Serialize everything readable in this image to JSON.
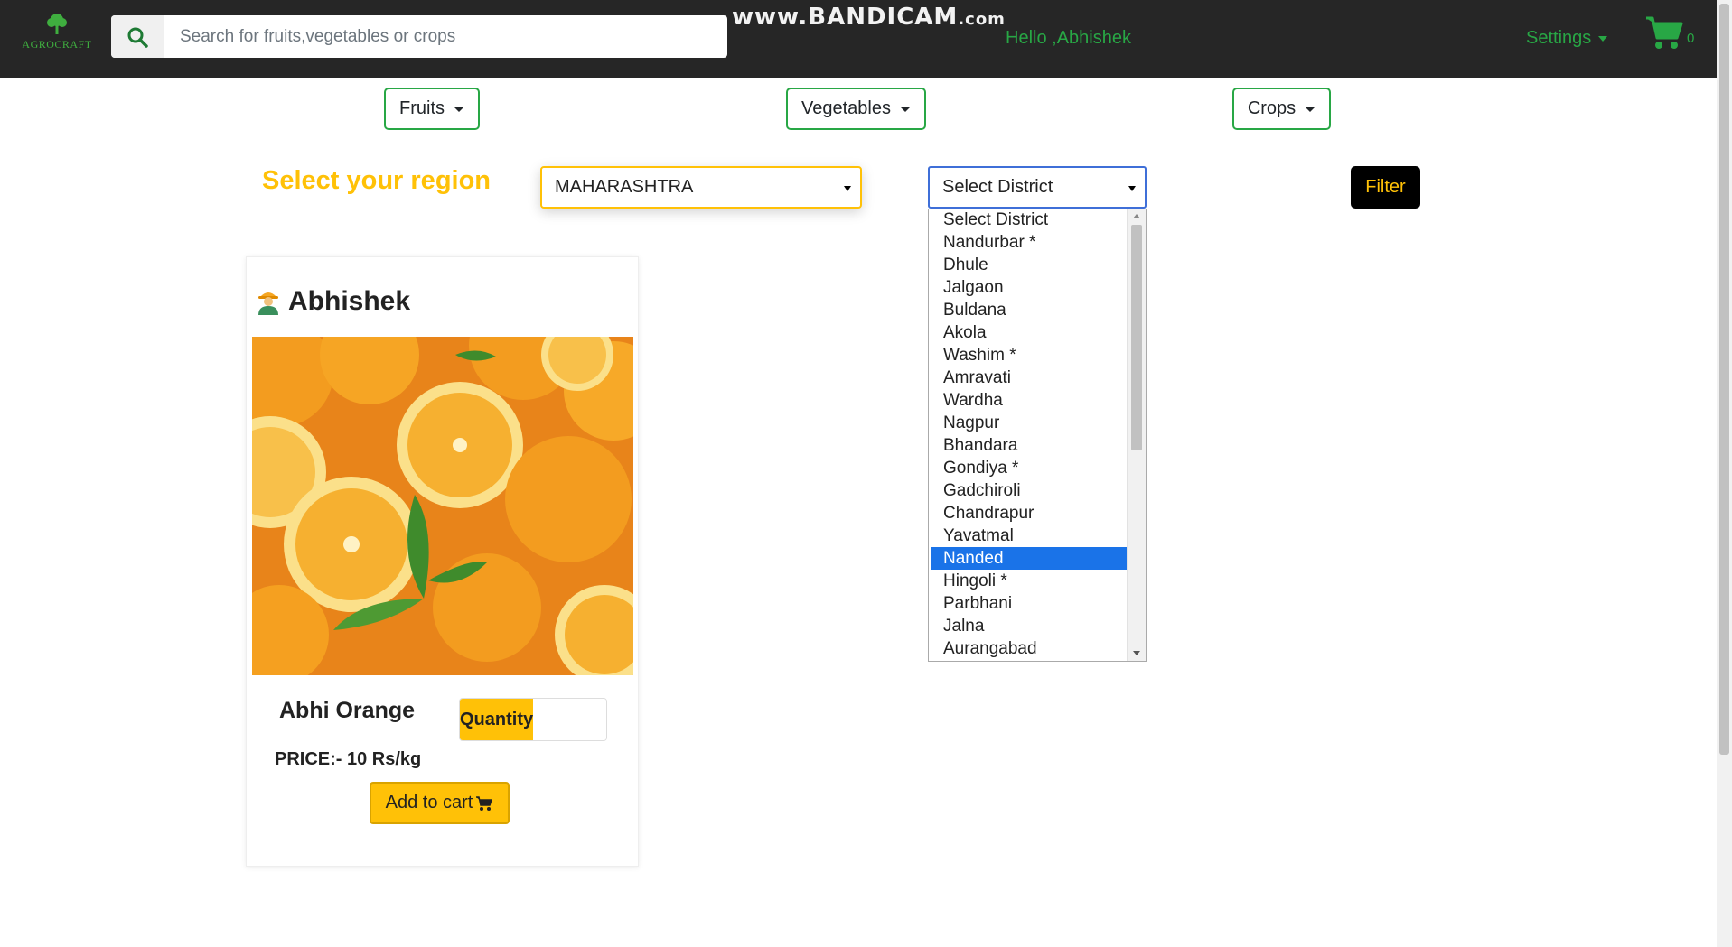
{
  "navbar": {
    "logo_text": "AGROCRAFT",
    "search_placeholder": "Search for fruits,vegetables or crops",
    "greeting": "Hello ,Abhishek",
    "settings_label": "Settings",
    "cart_count": "0",
    "accent_color": "#28a745"
  },
  "watermark": {
    "main": "www.BANDICAM",
    "suffix": ".com"
  },
  "categories": [
    "Fruits",
    "Vegetables",
    "Crops"
  ],
  "region": {
    "title": "Select your region",
    "state_value": "MAHARASHTRA",
    "district_value": "Select District",
    "filter_label": "Filter",
    "district_options": [
      "Select District",
      "Nandurbar *",
      "Dhule",
      "Jalgaon",
      "Buldana",
      "Akola",
      "Washim *",
      "Amravati",
      "Wardha",
      "Nagpur",
      "Bhandara",
      "Gondiya *",
      "Gadchiroli",
      "Chandrapur",
      "Yavatmal",
      "Nanded",
      "Hingoli *",
      "Parbhani",
      "Jalna",
      "Aurangabad"
    ],
    "highlighted_option": "Nanded"
  },
  "card": {
    "farmer_name": "Abhishek",
    "product_name": "Abhi Orange",
    "quantity_label": "Quantity",
    "price": "PRICE:- 10 Rs/kg",
    "add_to_cart_label": "Add to cart"
  },
  "colors": {
    "yellow": "#ffc107",
    "green": "#28a745",
    "navbar": "#262626"
  }
}
